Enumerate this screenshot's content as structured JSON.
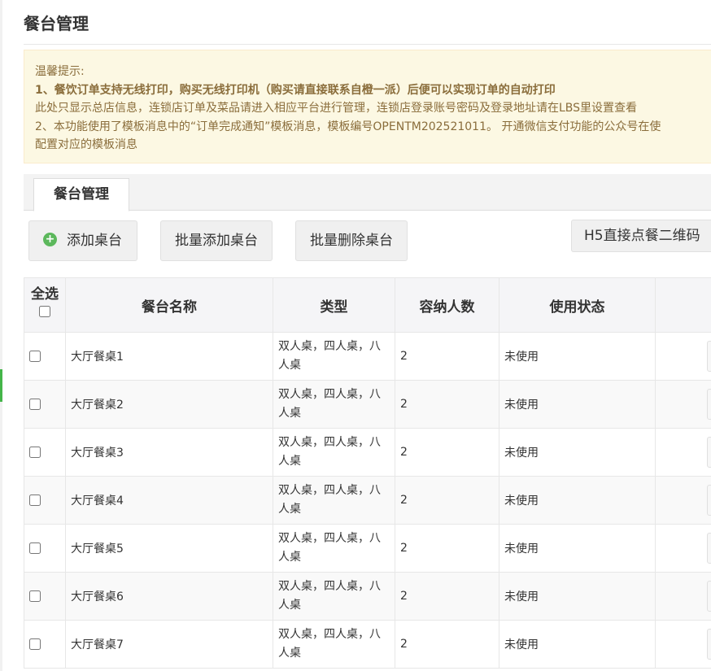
{
  "page": {
    "title": "餐台管理"
  },
  "notice": {
    "heading": "温馨提示:",
    "line1": "1、餐饮订单支持无线打印，购买无线打印机（购买请直接联系自橙一派）后便可以实现订单的自动打印",
    "line2": "此处只显示总店信息，连锁店订单及菜品请进入相应平台进行管理，连锁店登录账号密码及登录地址请在LBS里设置查看",
    "line3": "2、本功能使用了模板消息中的“订单完成通知”模板消息，模板编号OPENTM202521011。 开通微信支付功能的公众号在使",
    "line4": "配置对应的模板消息"
  },
  "tabs": [
    {
      "label": "餐台管理"
    }
  ],
  "toolbar": {
    "add_icon": "plus-circle-icon",
    "add_label": "添加桌台",
    "batch_add_label": "批量添加桌台",
    "batch_delete_label": "批量删除桌台",
    "qr_label": "H5直接点餐二维码"
  },
  "table": {
    "headers": {
      "select_all": "全选",
      "name": "餐台名称",
      "type": "类型",
      "capacity": "容纳人数",
      "status": "使用状态"
    },
    "rows": [
      {
        "name": "大厅餐桌1",
        "type": "双人桌，四人桌，八人桌",
        "capacity": "2",
        "status": "未使用"
      },
      {
        "name": "大厅餐桌2",
        "type": "双人桌，四人桌，八人桌",
        "capacity": "2",
        "status": "未使用"
      },
      {
        "name": "大厅餐桌3",
        "type": "双人桌，四人桌，八人桌",
        "capacity": "2",
        "status": "未使用"
      },
      {
        "name": "大厅餐桌4",
        "type": "双人桌，四人桌，八人桌",
        "capacity": "2",
        "status": "未使用"
      },
      {
        "name": "大厅餐桌5",
        "type": "双人桌，四人桌，八人桌",
        "capacity": "2",
        "status": "未使用"
      },
      {
        "name": "大厅餐桌6",
        "type": "双人桌，四人桌，八人桌",
        "capacity": "2",
        "status": "未使用"
      },
      {
        "name": "大厅餐桌7",
        "type": "双人桌，四人桌，八人桌",
        "capacity": "2",
        "status": "未使用"
      }
    ]
  },
  "colors": {
    "accent": "#44b549",
    "notice_bg": "#fcf8e3",
    "notice_text": "#8a6d3b"
  }
}
